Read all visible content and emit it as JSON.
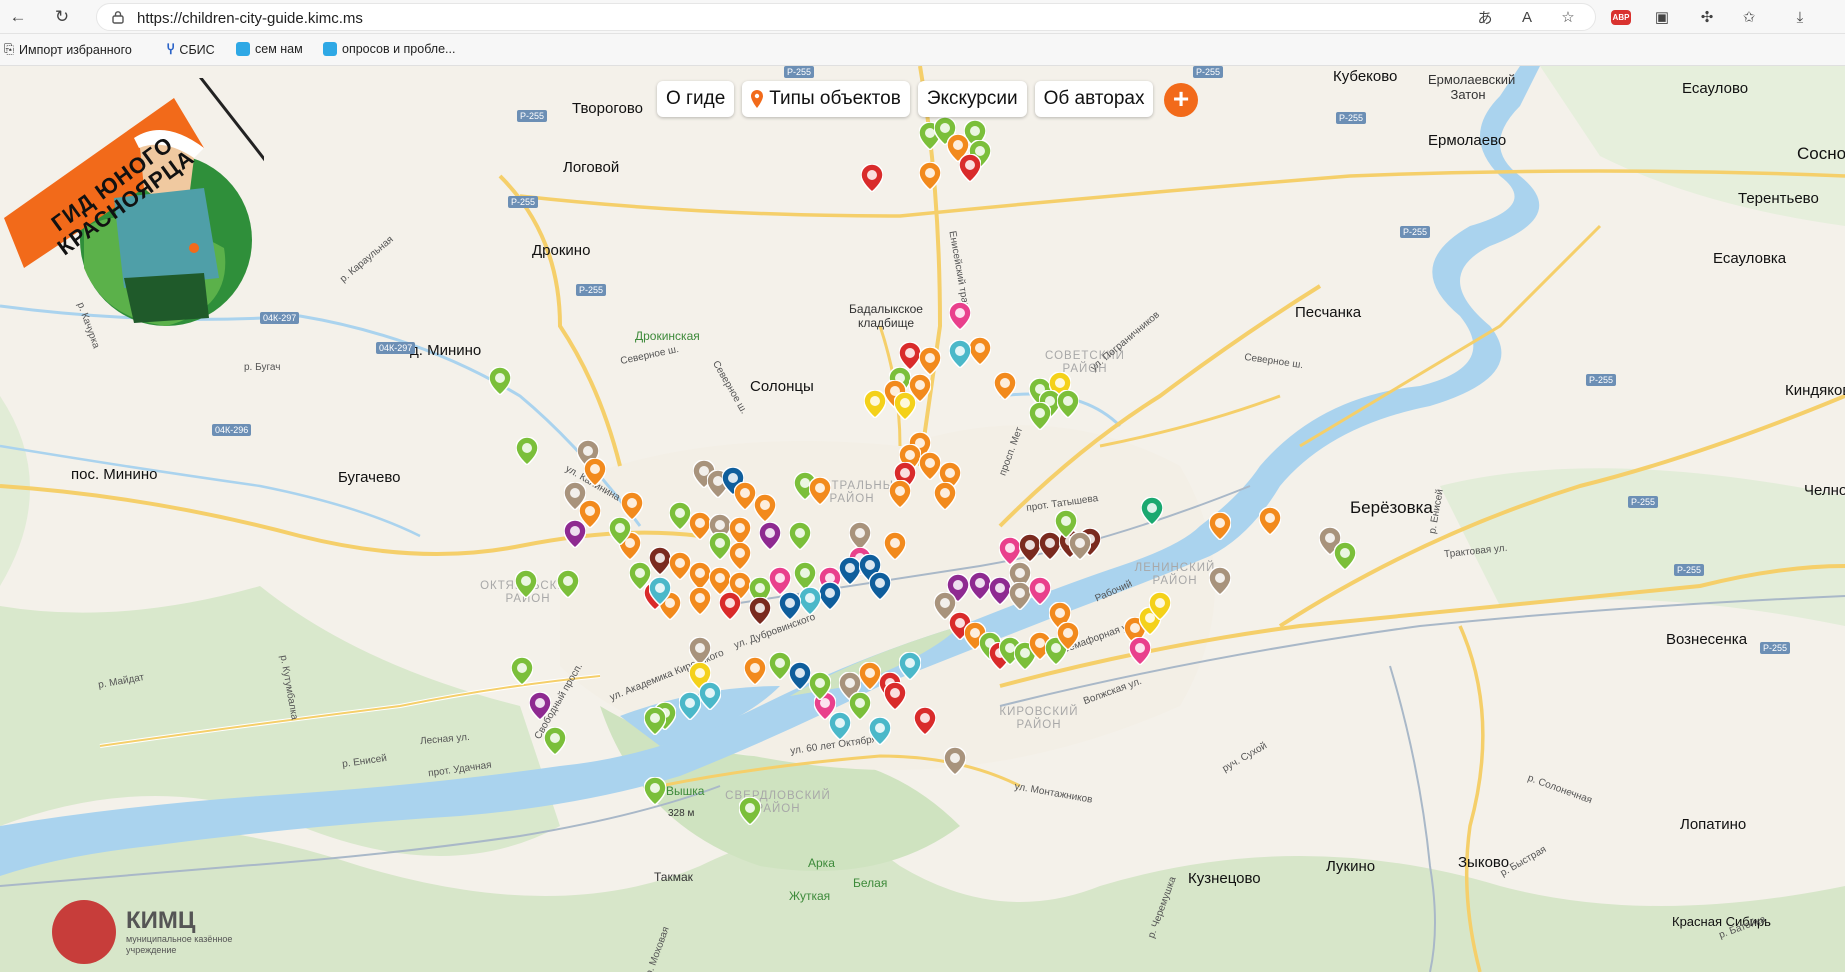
{
  "browser": {
    "url": "https://children-city-guide.kimc.ms",
    "icons": [
      "back-icon",
      "reload-icon",
      "lock-icon",
      "read-aloud-icon",
      "text-size-icon",
      "favorite-star-icon",
      "adblock-icon",
      "collections-icon",
      "extensions-icon",
      "favorites-icon",
      "downloads-icon"
    ],
    "adblock_label": "ABP"
  },
  "bookmarks": [
    {
      "label": "Импорт избранного"
    },
    {
      "label": "СБИС"
    },
    {
      "label": "сем нам"
    },
    {
      "label": "опросов  и пробле..."
    }
  ],
  "nav": {
    "about": "О гиде",
    "types": "Типы объектов",
    "tours": "Экскурсии",
    "authors": "Об авторах",
    "plus": "+"
  },
  "logo": {
    "line1": "ГИД ЮНОГО",
    "line2": "КРАСНОЯРЦА"
  },
  "org": {
    "title": "КИМЦ",
    "subtitle1": "муниципальное казённое",
    "subtitle2": "учреждение"
  },
  "map_labels": {
    "tvorogovo": "Творогово",
    "logovoy": "Логовой",
    "drokino": "Дрокино",
    "minino": "д. Минино",
    "pos_minino": "пос. Минино",
    "bugachevo": "Бугачево",
    "solontsy": "Солонцы",
    "drokinskaya": "Дрокинская",
    "badalyk": "Бадалыкское кладбище",
    "kubekovo": "Кубеково",
    "ermolaevsky": "Ермолаевский Затон",
    "esaulovo": "Есаулово",
    "ermolaevo": "Ермолаево",
    "terentevo": "Терентьево",
    "esaulovka": "Есауловка",
    "sosno": "Сосно",
    "peschanka": "Песчанка",
    "kindyakovo": "Киндяково",
    "berezovka": "Берёзовка",
    "chelno": "Челно",
    "voznesenka": "Вознесенка",
    "lopatino": "Лопатино",
    "zykovo": "Зыково",
    "lukino": "Лукино",
    "kuznetsovo": "Кузнецово",
    "krasnaya_sibir": "Красная Сибирь",
    "vyshka": "Вышка",
    "vyshka_h": "328 м",
    "takmak": "Такмак",
    "arka": "Арка",
    "belaya": "Белая",
    "zhutkaya": "Жуткая",
    "d_central": "ЦЕНТРАЛЬНЫЙ РАЙОН",
    "d_oktyabr": "ОКТЯБРЬСКИЙ РАЙОН",
    "d_soviet": "СОВЕТСКИЙ РАЙОН",
    "d_lenin": "ЛЕНИНСКИЙ РАЙОН",
    "d_kirov": "КИРОВСКИЙ РАЙОН",
    "d_sverdl": "СВЕРДЛОВСКИЙ РАЙОН",
    "r_karaulnaya": "р. Караульная",
    "r_bugach": "р. Бугач",
    "r_kachurka": "р. Качурка",
    "r_yenisei": "р. Енисей",
    "r_mayda": "р. Майдат",
    "r_kuyumba": "р. Кутумбалка",
    "r_bazaikha": "р. Базаиха",
    "r_sukhoy": "руч. Сухой",
    "r_solonech": "р. Солонечная",
    "r_bystraya": "р. Быстрая",
    "r_batoi": "р. Батойка",
    "r_tatysheva": "прот. Татышева",
    "r_udachnaya": "прот. Удачная",
    "r_molokova": "р. Моховая",
    "r_chermushka": "р. Черемушка",
    "s_kalinina": "ул. Калинина",
    "s_severnoe": "Северное ш.",
    "s_severnoe2": "Северное ш.",
    "s_severnoe3": "Северное ш.",
    "s_yenisei": "Енисейский тракт",
    "s_pogran": "ул. Пограничников",
    "s_trakt": "Трактовая ул.",
    "s_semafor": "Семафорная ул.",
    "s_volzhskaya": "Волжская ул.",
    "s_montazh": "ул. Монтажников",
    "s_akadem": "ул. Академика Киренского",
    "s_lesnaya": "Лесная ул.",
    "s_svobod": "Свободный просп.",
    "s_60let": "ул. 60 лет Октября",
    "s_dubrov": "ул. Дубровинского",
    "s_rabochiy": "Рабочий",
    "s_met": "просп. Мет",
    "hw_p255": "Р-255",
    "hw_04k297": "04К-297",
    "hw_04k296": "04К-296"
  },
  "colors": {
    "water": "#aad3ee",
    "forest": "#d7e8cb",
    "road_major": "#f5cf6a",
    "accent_orange": "#f26a1a"
  }
}
